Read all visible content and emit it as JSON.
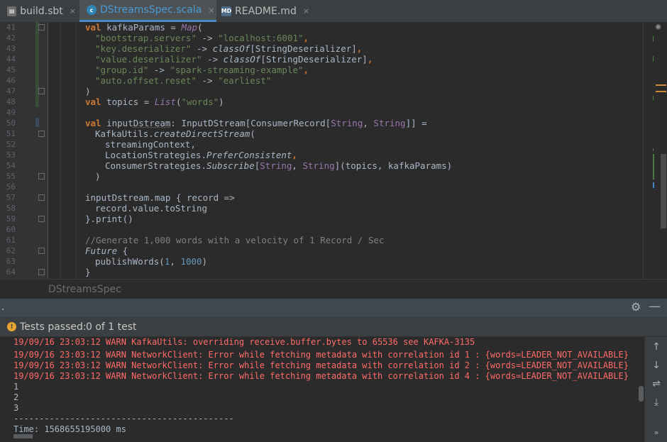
{
  "tabs": [
    {
      "label": "build.sbt",
      "icon": "sbt-file-icon",
      "active": false
    },
    {
      "label": "DStreamsSpec.scala",
      "icon": "scala-file-icon",
      "active": true
    },
    {
      "label": "README.md",
      "icon": "markdown-file-icon",
      "active": false
    }
  ],
  "tab_close_glyph": "×",
  "editor": {
    "line_numbers": [
      "41",
      "42",
      "43",
      "44",
      "45",
      "46",
      "47",
      "48",
      "49",
      "50",
      "51",
      "52",
      "53",
      "54",
      "55",
      "56",
      "57",
      "58",
      "59",
      "60",
      "61",
      "62",
      "63",
      "64"
    ],
    "code": {
      "l41": {
        "kw": "val",
        "name": " kafkaParams = ",
        "fn": "Map",
        "rest": "("
      },
      "l42": {
        "a": "\"bootstrap.servers\"",
        "arrow": " -> ",
        "b": "\"localhost:6001\"",
        "end": ","
      },
      "l43": {
        "a": "\"key.deserializer\"",
        "arrow": " -> ",
        "fn": "classOf",
        "type": "[StringDeserializer]",
        "end": ","
      },
      "l44": {
        "a": "\"value.deserializer\"",
        "arrow": " -> ",
        "fn": "classOf",
        "type": "[StringDeserializer]",
        "end": ","
      },
      "l45": {
        "a": "\"group.id\"",
        "arrow": " -> ",
        "b": "\"spark-streaming-example\"",
        "end": ","
      },
      "l46": {
        "a": "\"auto.offset.reset\"",
        "arrow": " -> ",
        "b": "\"earliest\""
      },
      "l47": {
        "text": ")"
      },
      "l48": {
        "kw": "val",
        "name": " topics = ",
        "fn": "List",
        "open": "(",
        "str": "\"words\"",
        "close": ")"
      },
      "l50": {
        "kw": "val",
        "pre": " input",
        "under": "Dstream",
        "type": ": InputDStream[ConsumerRecord[",
        "t1": "String",
        "sep": ", ",
        "t2": "String",
        "end": "]] ="
      },
      "l51": {
        "obj": "KafkaUtils.",
        "fn": "createDirectStream",
        "rest": "("
      },
      "l52": {
        "text": "streamingContext,"
      },
      "l53": {
        "obj": "LocationStrategies.",
        "fn": "PreferConsistent",
        "end": ","
      },
      "l54": {
        "obj": "ConsumerStrategies.",
        "fn": "Subscribe",
        "open": "[",
        "t1": "String",
        "sep": ", ",
        "t2": "String",
        "rest": "](topics, kafkaParams)"
      },
      "l55": {
        "text": ")"
      },
      "l57": {
        "text": "inputDstream.map { record =>"
      },
      "l58": {
        "text": "record.value.toString"
      },
      "l59": {
        "text": "}.print()"
      },
      "l61": {
        "text": "//Generate 1,000 words with a velocity of 1 Record / Sec"
      },
      "l62": {
        "fn": "Future",
        "rest": " {"
      },
      "l63": {
        "pre": "publishWords(",
        "n1": "1",
        "sep": ", ",
        "n2": "1000",
        "end": ")"
      },
      "l64": {
        "text": "}"
      }
    }
  },
  "breadcrumb": "DStreamsSpec",
  "run_panel": {
    "toolbar_label": ".",
    "status_icon": "warning-icon",
    "status_label": "Tests passed: ",
    "status_count": "0 of 1 test"
  },
  "console": {
    "lines": [
      {
        "text": "19/09/16 23:03:12 WARN KafkaUtils: overriding receive.buffer.bytes to 65536 see KAFKA-3135",
        "kind": "err"
      },
      {
        "text": "19/09/16 23:03:12 WARN NetworkClient: Error while fetching metadata with correlation id 1 : {words=LEADER_NOT_AVAILABLE}",
        "kind": "err"
      },
      {
        "text": "19/09/16 23:03:12 WARN NetworkClient: Error while fetching metadata with correlation id 2 : {words=LEADER_NOT_AVAILABLE}",
        "kind": "err"
      },
      {
        "text": "19/09/16 23:03:12 WARN NetworkClient: Error while fetching metadata with correlation id 4 : {words=LEADER_NOT_AVAILABLE}",
        "kind": "err"
      },
      {
        "text": "1",
        "kind": "out"
      },
      {
        "text": "2",
        "kind": "out"
      },
      {
        "text": "3",
        "kind": "out"
      },
      {
        "text": "-------------------------------------------",
        "kind": "out"
      },
      {
        "text": "Time: 1568655195000 ms",
        "kind": "out"
      }
    ]
  },
  "colors": {
    "accent": "#4a88c7",
    "error_text": "#ff6b68",
    "warning_badge": "#e8a534"
  }
}
